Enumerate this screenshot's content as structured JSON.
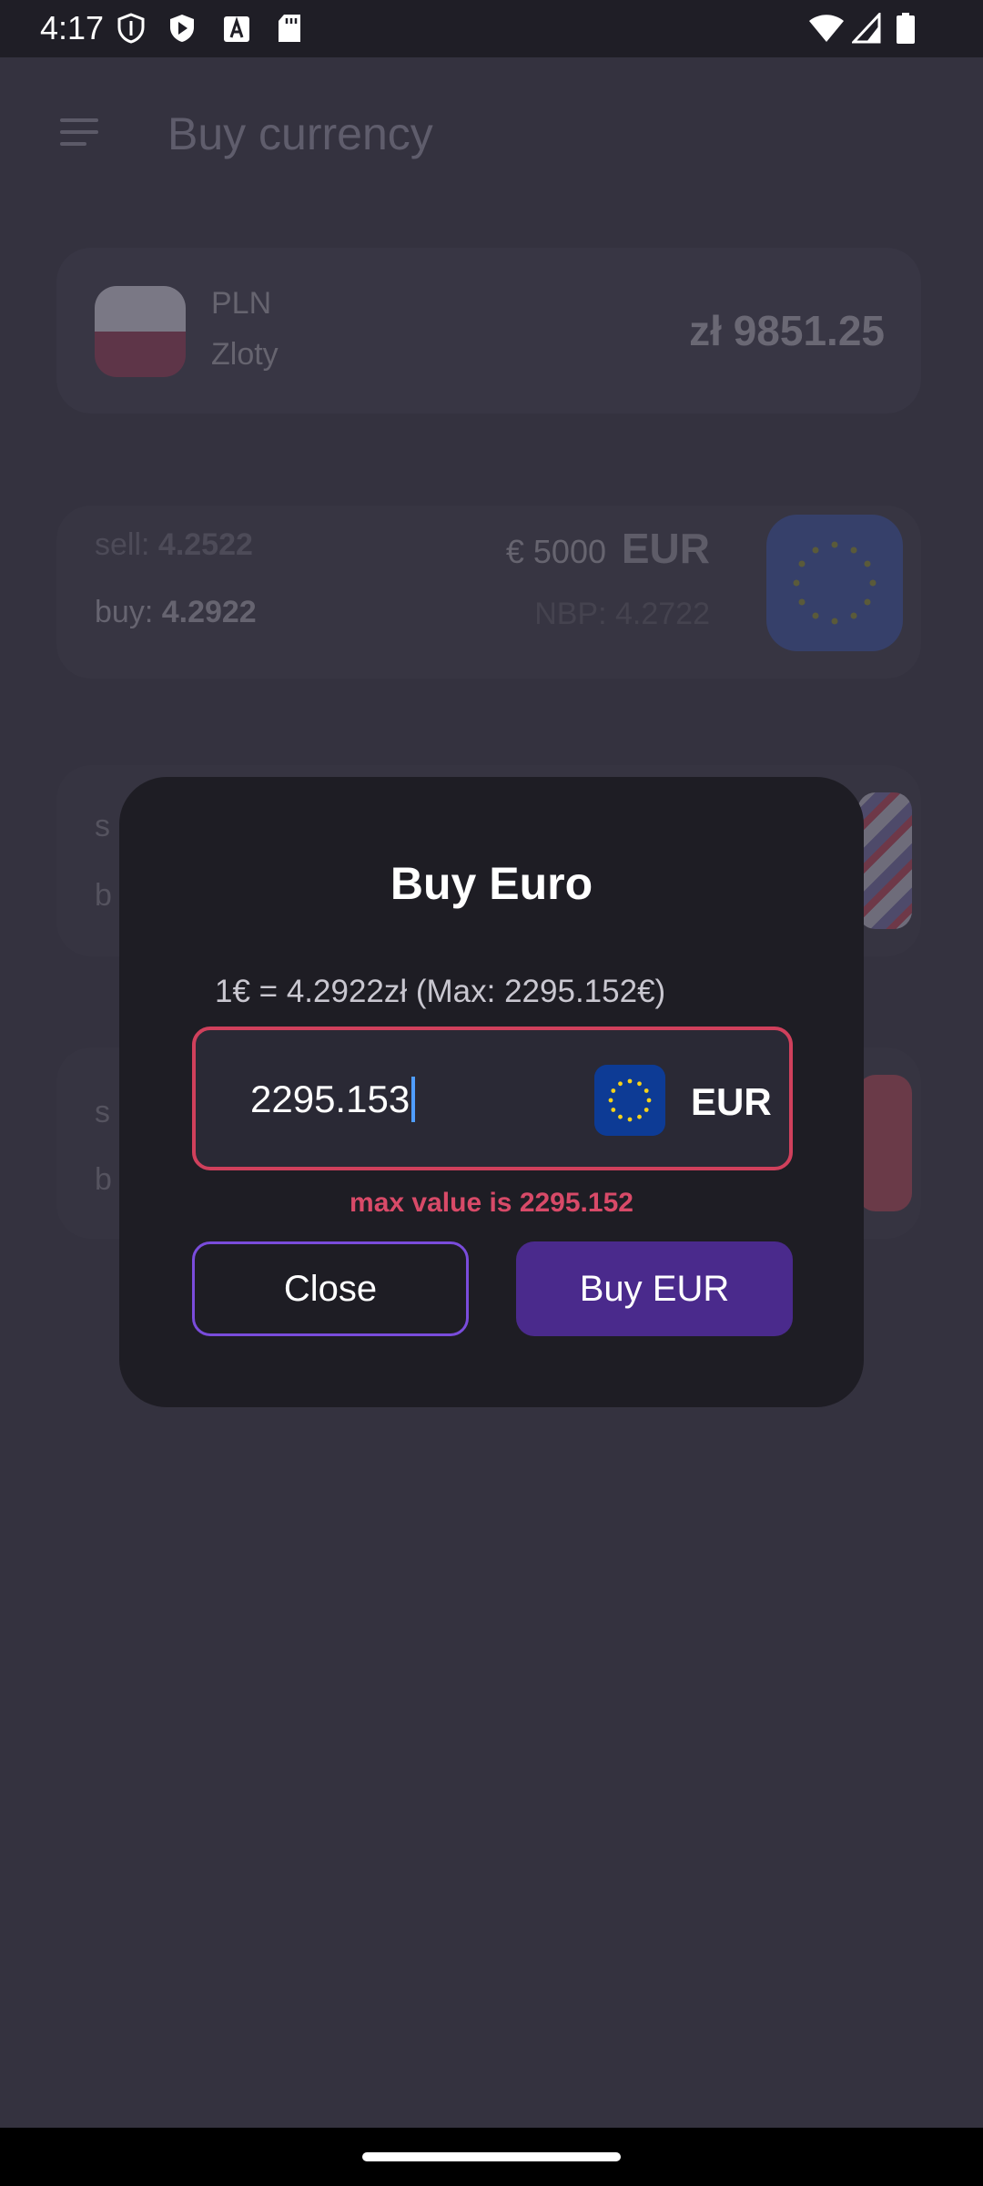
{
  "status_bar": {
    "time": "4:17",
    "left_icons": [
      "shield-icon",
      "play-protect-icon",
      "font-icon",
      "sd-card-icon"
    ],
    "right_icons": [
      "wifi-icon",
      "signal-icon",
      "battery-icon"
    ]
  },
  "app_bar": {
    "title": "Buy currency"
  },
  "background": {
    "pln_card": {
      "code": "PLN",
      "name": "Zloty",
      "balance": "zł 9851.25"
    },
    "eur_card": {
      "sell_label": "sell:",
      "sell_value": "4.2522",
      "buy_label": "buy:",
      "buy_value": "4.2922",
      "amount": "€ 5000",
      "code": "EUR",
      "nbp": "NBP: 4.2722"
    },
    "card3": {
      "line1": "s",
      "line2": "b"
    },
    "card4": {
      "line1": "s",
      "line2": "b"
    }
  },
  "dialog": {
    "title": "Buy Euro",
    "rate_info": "1€ = 4.2922zł (Max: 2295.152€)",
    "input_value": "2295.153",
    "input_currency": "EUR",
    "error": "max value is 2295.152",
    "close_label": "Close",
    "buy_label": "Buy EUR"
  },
  "colors": {
    "error": "#d84a68",
    "accent": "#4a2a8c",
    "outline": "#7a4cdc",
    "eu_blue": "#0d3b95",
    "eu_star": "#f5d21a"
  }
}
